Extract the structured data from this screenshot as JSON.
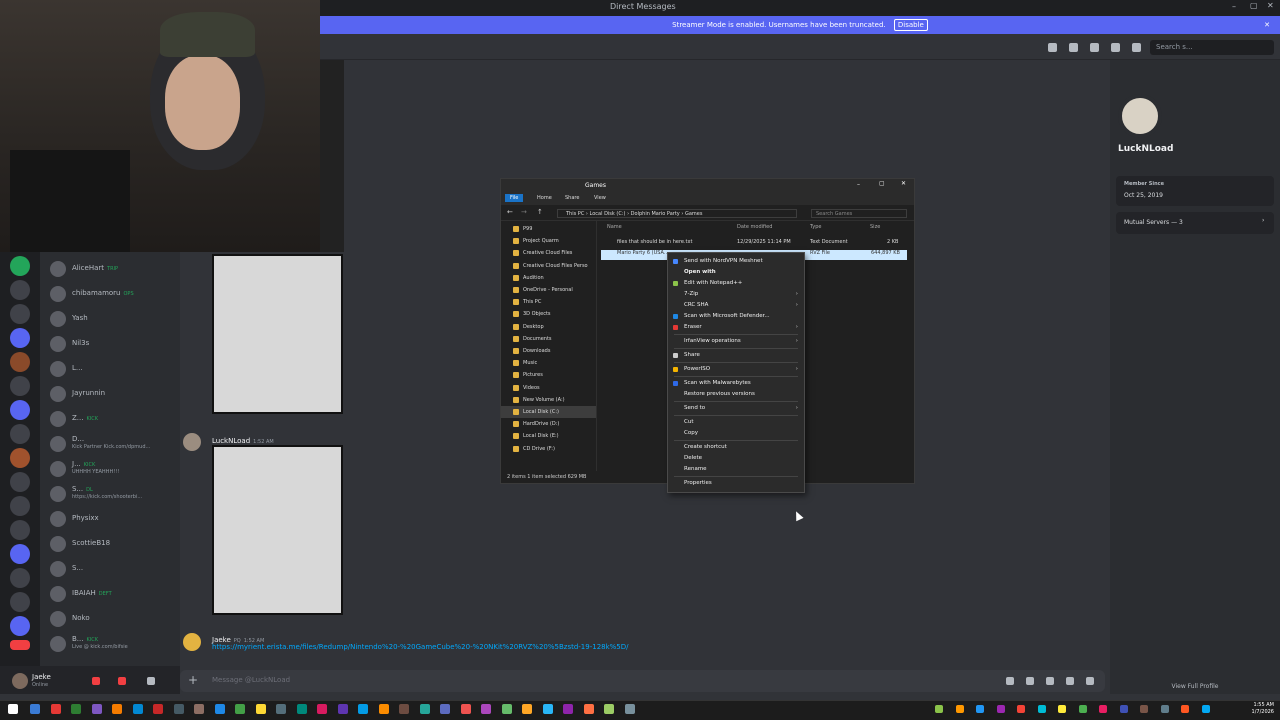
{
  "window": {
    "title": "Direct Messages"
  },
  "banner": {
    "text": "Streamer Mode is enabled. Usernames have been truncated.",
    "disable_label": "Disable"
  },
  "header": {
    "search_placeholder": "Search s..."
  },
  "dm_list": [
    {
      "name": "AliceHart",
      "tag": "TRIP",
      "sub": ""
    },
    {
      "name": "chibamamoru",
      "tag": "OPS",
      "sub": ""
    },
    {
      "name": "Yash",
      "tag": "",
      "sub": ""
    },
    {
      "name": "Nil3s",
      "tag": "",
      "sub": ""
    },
    {
      "name": "L...",
      "tag": "",
      "sub": ""
    },
    {
      "name": "Jayrunnin",
      "tag": "",
      "sub": ""
    },
    {
      "name": "Z...",
      "tag": "KICK",
      "sub": ""
    },
    {
      "name": "D...",
      "tag": "",
      "sub": "Kick Partner Kick.com/dpmud..."
    },
    {
      "name": "J...",
      "tag": "KICK",
      "sub": "UHHHH YEAHHH!!!"
    },
    {
      "name": "S...",
      "tag": "DL",
      "sub": "https://kick.com/shooterbi..."
    },
    {
      "name": "Physixx",
      "tag": "",
      "sub": ""
    },
    {
      "name": "ScottieB18",
      "tag": "",
      "sub": ""
    },
    {
      "name": "S...",
      "tag": "",
      "sub": ""
    },
    {
      "name": "IBAIAH",
      "tag": "DEFT",
      "sub": ""
    },
    {
      "name": "Noko",
      "tag": "",
      "sub": ""
    },
    {
      "name": "B...",
      "tag": "KICK",
      "sub": "Live @ kick.com/bifsie"
    }
  ],
  "user_panel": {
    "name": "Jaeke",
    "status": "Online"
  },
  "chat": {
    "msg1": {
      "author": "LuckNLoad",
      "time": "1:52 AM"
    },
    "msg2": {
      "author": "Jaeke",
      "tag": "PQ",
      "time": "1:52 AM",
      "link": "https://myrient.erista.me/files/Redump/Nintendo%20-%20GameCube%20-%20NKit%20RVZ%20%5Bzstd-19-128k%5D/"
    },
    "composer_placeholder": "Message @LuckNLoad"
  },
  "profile": {
    "name": "LuckNLoad",
    "member_since_label": "Member Since",
    "member_since": "Oct 25, 2019",
    "mutual_servers": "Mutual Servers — 3",
    "view_full": "View Full Profile"
  },
  "explorer": {
    "title": "Games",
    "ribbon": [
      "File",
      "Home",
      "Share",
      "View"
    ],
    "path": [
      "This PC",
      "Local Disk (C:)",
      "Dolphin Mario Party",
      "Games"
    ],
    "search_placeholder": "Search Games",
    "nav": [
      "P99",
      "Project Quarm",
      "Creative Cloud Files",
      "Creative Cloud Files Perso",
      "Audition",
      "OneDrive - Personal",
      "This PC",
      "3D Objects",
      "Desktop",
      "Documents",
      "Downloads",
      "Music",
      "Pictures",
      "Videos",
      "New Volume (A:)",
      "Local Disk (C:)",
      "HardDrive (D:)",
      "Local Disk (E:)",
      "CD Drive (F:)"
    ],
    "columns": [
      "Name",
      "Date modified",
      "Type",
      "Size"
    ],
    "files": [
      {
        "name": "files that should be in here.txt",
        "date": "12/29/2025 11:14 PM",
        "type": "Text Document",
        "size": "2 KB"
      },
      {
        "name": "Mario Party 6 (USA...",
        "date": "",
        "type": "RVZ File",
        "size": "644,897 KB"
      }
    ],
    "status": "2 items    1 item selected  629 MB"
  },
  "context_menu": [
    {
      "label": "Send with NordVPN Meshnet",
      "sub": false,
      "bold": false,
      "icon": "nordvpn-icon"
    },
    {
      "label": "Open with",
      "sub": false,
      "bold": true,
      "icon": ""
    },
    {
      "label": "Edit with Notepad++",
      "sub": false,
      "bold": false,
      "icon": "notepadpp-icon"
    },
    {
      "label": "7-Zip",
      "sub": true,
      "bold": false,
      "icon": ""
    },
    {
      "label": "CRC SHA",
      "sub": true,
      "bold": false,
      "icon": ""
    },
    {
      "label": "Scan with Microsoft Defender...",
      "sub": false,
      "bold": false,
      "icon": "defender-icon"
    },
    {
      "label": "Eraser",
      "sub": true,
      "bold": false,
      "icon": "eraser-icon"
    },
    {
      "sep": true
    },
    {
      "label": "IrfanView operations",
      "sub": true,
      "bold": false,
      "icon": ""
    },
    {
      "sep": true
    },
    {
      "label": "Share",
      "sub": false,
      "bold": false,
      "icon": "share-icon"
    },
    {
      "sep": true
    },
    {
      "label": "PowerISO",
      "sub": true,
      "bold": false,
      "icon": "poweriso-icon"
    },
    {
      "sep": true
    },
    {
      "label": "Scan with Malwarebytes",
      "sub": false,
      "bold": false,
      "icon": "malwarebytes-icon"
    },
    {
      "label": "Restore previous versions",
      "sub": false,
      "bold": false,
      "icon": ""
    },
    {
      "sep": true
    },
    {
      "label": "Send to",
      "sub": true,
      "bold": false,
      "icon": ""
    },
    {
      "sep": true
    },
    {
      "label": "Cut",
      "sub": false,
      "bold": false,
      "icon": ""
    },
    {
      "label": "Copy",
      "sub": false,
      "bold": false,
      "icon": ""
    },
    {
      "sep": true
    },
    {
      "label": "Create shortcut",
      "sub": false,
      "bold": false,
      "icon": ""
    },
    {
      "label": "Delete",
      "sub": false,
      "bold": false,
      "icon": ""
    },
    {
      "label": "Rename",
      "sub": false,
      "bold": false,
      "icon": ""
    },
    {
      "sep": true
    },
    {
      "label": "Properties",
      "sub": false,
      "bold": false,
      "icon": ""
    }
  ],
  "taskbar": {
    "time": "1:55 AM",
    "date": "1/7/2026"
  },
  "colors": {
    "accent": "#5865f2",
    "link": "#00a8fc",
    "online": "#23a55a"
  }
}
